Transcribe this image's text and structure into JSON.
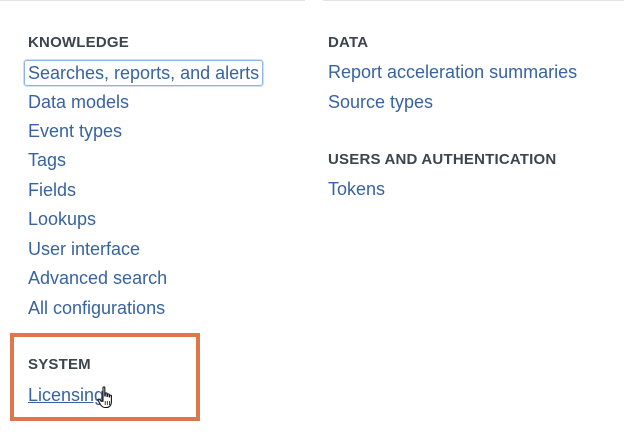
{
  "knowledge": {
    "heading": "KNOWLEDGE",
    "links": [
      "Searches, reports, and alerts",
      "Data models",
      "Event types",
      "Tags",
      "Fields",
      "Lookups",
      "User interface",
      "Advanced search",
      "All configurations"
    ]
  },
  "system": {
    "heading": "SYSTEM",
    "links": [
      "Licensing"
    ],
    "highlight_color": "#e0774a"
  },
  "data": {
    "heading": "DATA",
    "links": [
      "Report acceleration summaries",
      "Source types"
    ]
  },
  "users_auth": {
    "heading": "USERS AND AUTHENTICATION",
    "links": [
      "Tokens"
    ]
  },
  "colors": {
    "link": "#3863a0",
    "heading": "#3c444d",
    "focus_ring": "#8fb3e3"
  },
  "cursor": {
    "icon": "hand-pointer-icon"
  }
}
